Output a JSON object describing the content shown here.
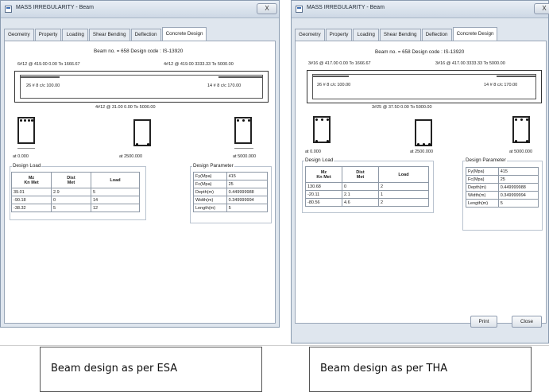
{
  "left_window": {
    "title": "MASS IRREGULARITY - Beam",
    "close": "X",
    "tabs": [
      "Geometry",
      "Property",
      "Loading",
      "Shear Bending",
      "Deflection",
      "Concrete Design"
    ],
    "active_tab": "Concrete Design",
    "header": "Beam no. = 658  Design code : IS-13920",
    "top_bars": [
      "6#12 @ 419.00 0.00 To 1666.67",
      "4#12 @ 419.00 3333.33 To 5000.00"
    ],
    "stirrups": [
      "26 # 8 c/c 100.00",
      "14 # 8 c/c 170.00"
    ],
    "bottom_bar": "4#12 @ 31.00 0.00 To 5000.00",
    "sections": [
      "at 0.000",
      "at 2500.000",
      "at 5000.000"
    ],
    "design_load": {
      "title": "Design Load",
      "columns": [
        "Mz\nKn Met",
        "Dist\nMet",
        "Load"
      ],
      "rows": [
        [
          "39.01",
          "2.9",
          "5"
        ],
        [
          "-90.18",
          "0",
          "14"
        ],
        [
          "-38.32",
          "5",
          "12"
        ]
      ]
    },
    "design_parameter": {
      "title": "Design Parameter",
      "rows": [
        [
          "Fy(Mpa)",
          "415"
        ],
        [
          "Fc(Mpa)",
          "25"
        ],
        [
          "Depth(m)",
          "0.449999988"
        ],
        [
          "Width(m)",
          "0.349999994"
        ],
        [
          "Length(m)",
          "5"
        ]
      ]
    }
  },
  "right_window": {
    "title": "MASS IRREGULARITY - Beam",
    "close": "X",
    "tabs": [
      "Geometry",
      "Property",
      "Loading",
      "Shear Bending",
      "Deflection",
      "Concrete Design"
    ],
    "active_tab": "Concrete Design",
    "header": "Beam no. = 658  Design code : IS-13920",
    "top_bars": [
      "3#16 @ 417.00 0.00 To 1666.67",
      "3#16 @ 417.00 3333.33 To 5000.00"
    ],
    "stirrups": [
      "26 # 8 c/c 100.00",
      "14 # 8 c/c 170.00"
    ],
    "bottom_bar": "3#25 @ 37.50 0.00 To 5000.00",
    "sections": [
      "at 0.000",
      "at 2500.000",
      "at 5000.000"
    ],
    "design_load": {
      "title": "Design Load",
      "columns": [
        "Mz\nKn Met",
        "Dist\nMet",
        "Load"
      ],
      "rows": [
        [
          "130.68",
          "0",
          "2"
        ],
        [
          "-20.11",
          "2.1",
          "1"
        ],
        [
          "-80.56",
          "4.6",
          "2"
        ]
      ]
    },
    "design_parameter": {
      "title": "Design Parameter",
      "rows": [
        [
          "Fy(Mpa)",
          "415"
        ],
        [
          "Fc(Mpa)",
          "25"
        ],
        [
          "Depth(m)",
          "0.449999988"
        ],
        [
          "Width(m)",
          "0.349999994"
        ],
        [
          "Length(m)",
          "5"
        ]
      ]
    },
    "buttons": {
      "print": "Print",
      "close": "Close"
    }
  },
  "captions": {
    "left": "Beam design as per ESA",
    "right": "Beam design as per THA"
  }
}
